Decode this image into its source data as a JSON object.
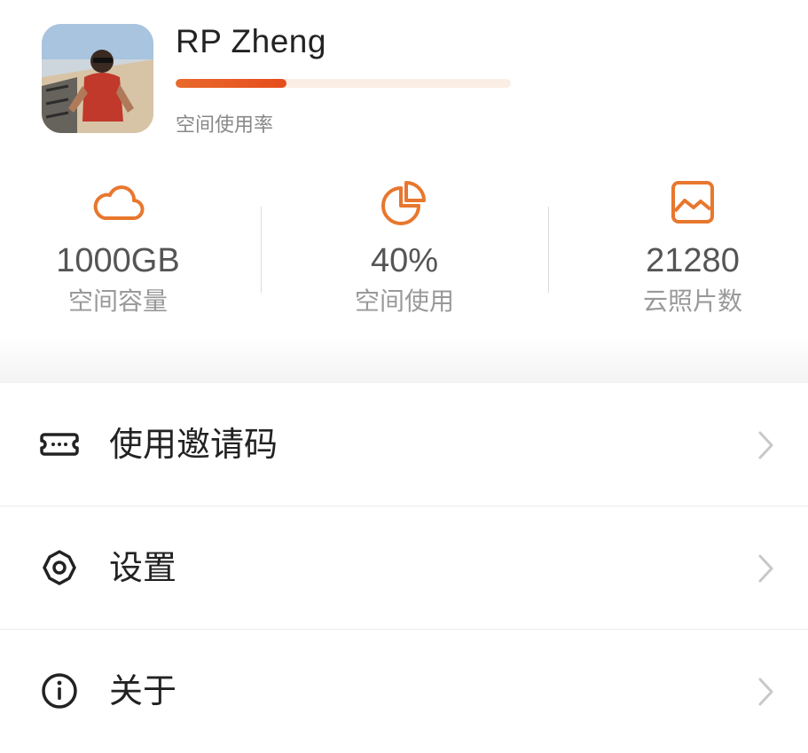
{
  "profile": {
    "name": "RP Zheng",
    "usage_fraction": 0.33,
    "usage_label": "空间使用率"
  },
  "stats": [
    {
      "icon": "cloud-icon",
      "value": "1000GB",
      "label": "空间容量"
    },
    {
      "icon": "pie-chart-icon",
      "value": "40%",
      "label": "空间使用"
    },
    {
      "icon": "image-icon",
      "value": "21280",
      "label": "云照片数"
    }
  ],
  "menu": [
    {
      "icon": "ticket-icon",
      "label": "使用邀请码"
    },
    {
      "icon": "gear-icon",
      "label": "设置"
    },
    {
      "icon": "info-icon",
      "label": "关于"
    }
  ],
  "colors": {
    "accent": "#e8772e",
    "bar": "#e6531f",
    "track": "#fbeee4"
  }
}
